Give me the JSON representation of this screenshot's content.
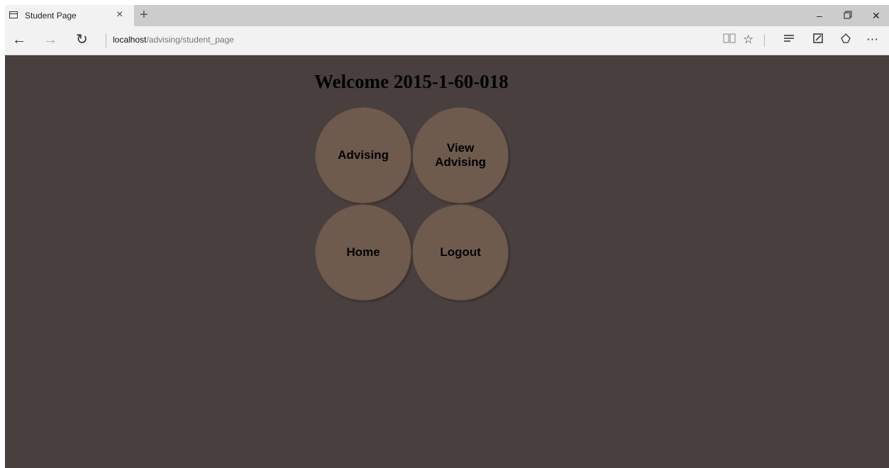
{
  "browser": {
    "tab_title": "Student Page",
    "tab_close": "×",
    "new_tab": "+",
    "address_host": "localhost",
    "address_path": "/advising/student_page",
    "icons": [
      "tab-page-icon",
      "back-icon",
      "forward-icon",
      "refresh-icon",
      "reading-view-icon",
      "favorite-star-icon",
      "hub-icon",
      "web-note-icon",
      "share-icon",
      "more-icon",
      "minimize-icon",
      "restore-icon",
      "close-window-icon"
    ]
  },
  "page": {
    "welcome": "Welcome 2015-1-60-018",
    "buttons": {
      "advising": "Advising",
      "view_advising": "View Advising",
      "home": "Home",
      "logout": "Logout"
    }
  },
  "colors": {
    "background": "#4a3f3f",
    "circle": "#6f5b4e",
    "tabbar": "#cccccc",
    "toolbar": "#f2f2f2"
  }
}
